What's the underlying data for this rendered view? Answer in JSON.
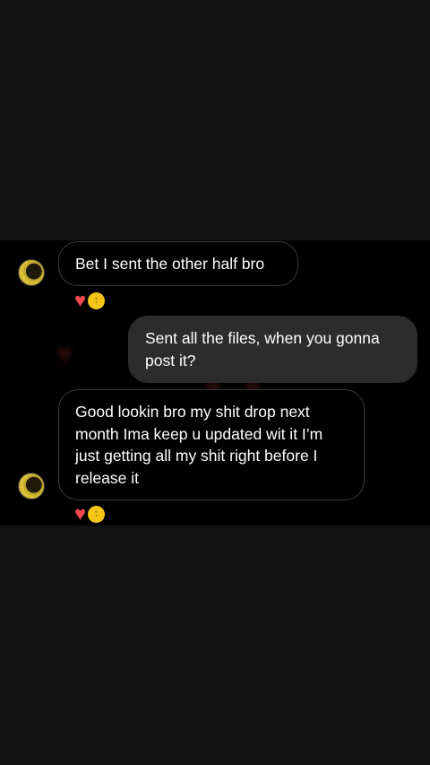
{
  "colors": {
    "page_background": "#121212",
    "chat_background": "#000000",
    "received_border": "#3b3b3b",
    "sent_bubble": "#2c2c2c",
    "heart": "#f04a4f",
    "badge": "#f5c518"
  },
  "messages": [
    {
      "direction": "received",
      "text": "Bet I sent the other half bro",
      "reactions": [
        "heart-icon",
        "sticker-badge-icon"
      ]
    },
    {
      "direction": "sent",
      "text": "Sent all the files, when you gonna post it?"
    },
    {
      "direction": "received",
      "text": "Good lookin bro my shit drop next month Ima keep u updated wit it I’m just getting all my shit right before I release it",
      "reactions": [
        "heart-icon",
        "sticker-badge-icon"
      ]
    }
  ],
  "icons": {
    "heart": "♥"
  }
}
